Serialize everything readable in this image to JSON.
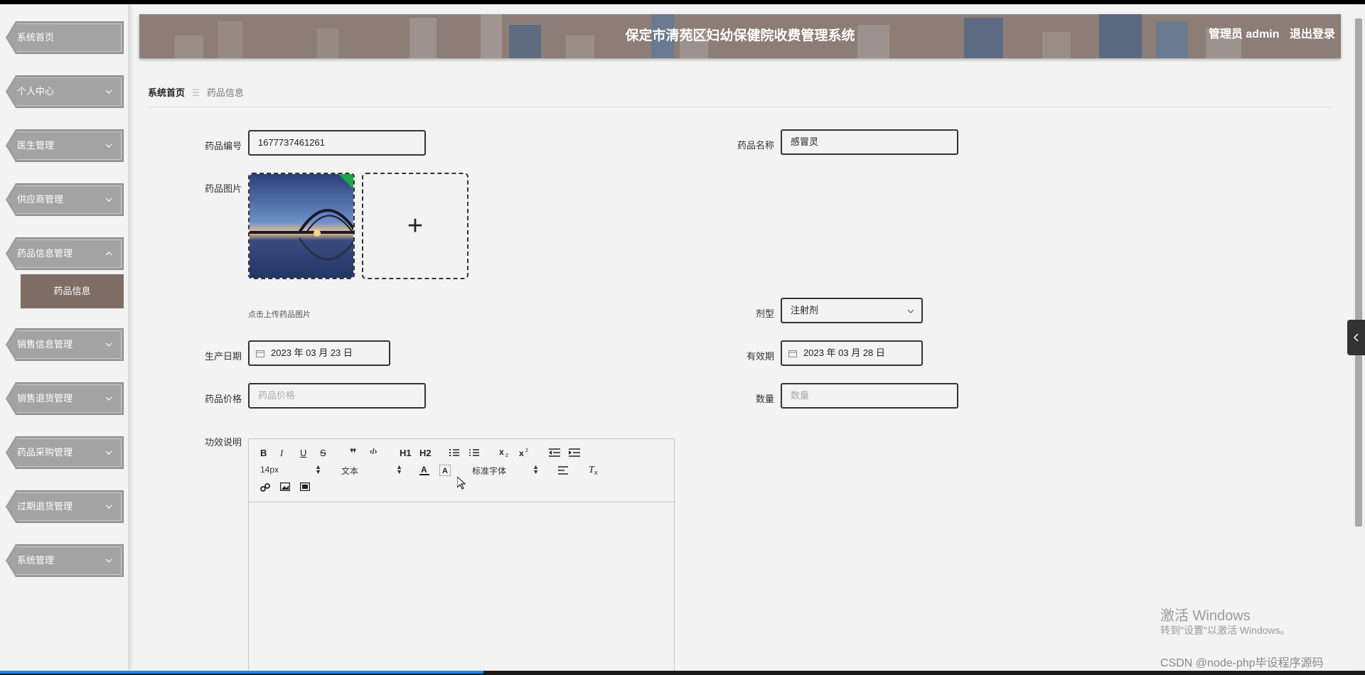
{
  "header": {
    "title": "保定市清苑区妇幼保健院收费管理系统",
    "user": "管理员 admin",
    "logout": "退出登录"
  },
  "sidebar": {
    "items": [
      {
        "label": "系统首页"
      },
      {
        "label": "个人中心"
      },
      {
        "label": "医生管理"
      },
      {
        "label": "供应商管理"
      },
      {
        "label": "药品信息管理"
      },
      {
        "label": "销售信息管理"
      },
      {
        "label": "销售退货管理"
      },
      {
        "label": "药品采购管理"
      },
      {
        "label": "过期退货管理"
      },
      {
        "label": "系统管理"
      }
    ],
    "active_sub": "药品信息"
  },
  "breadcrumb": {
    "home": "系统首页",
    "current": "药品信息"
  },
  "form": {
    "code_label": "药品编号",
    "code_value": "1677737461261",
    "name_label": "药品名称",
    "name_value": "感冒灵",
    "image_label": "药品图片",
    "upload_hint": "点击上传药品图片",
    "dosage_label": "剂型",
    "dosage_value": "注射剂",
    "prod_date_label": "生产日期",
    "prod_date_value": "2023 年 03 月 23 日",
    "expiry_label": "有效期",
    "expiry_value": "2023 年 03 月 28 日",
    "price_label": "药品价格",
    "price_placeholder": "药品价格",
    "qty_label": "数量",
    "qty_placeholder": "数量",
    "desc_label": "功效说明"
  },
  "editor": {
    "font_size": "14px",
    "text_type": "文本",
    "font_family": "标准字体",
    "buttons": [
      "B",
      "I",
      "U",
      "S",
      "❞",
      "‹/›",
      "H1",
      "H2"
    ]
  },
  "watermark": {
    "line1": "激活 Windows",
    "line2": "转到\"设置\"以激活 Windows。",
    "csdn": "CSDN @node-php毕设程序源码"
  }
}
